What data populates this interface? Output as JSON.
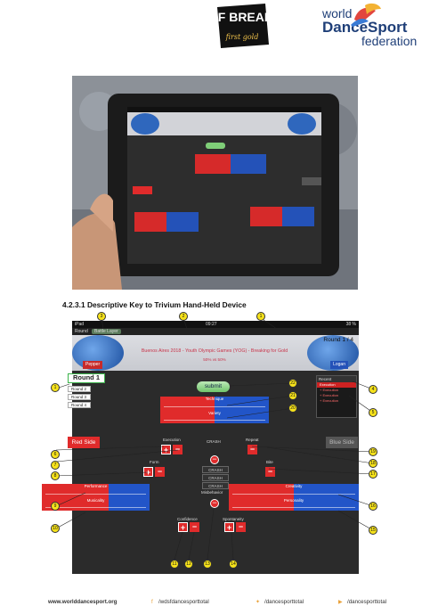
{
  "header": {
    "event_logo_text": "WDSF BREAKING",
    "event_logo_sub": "first gold",
    "org_world": "world",
    "org_dancesport": "DanceSport",
    "org_federation": "federation"
  },
  "section_title": "4.2.3.1 Descriptive Key to Trivium Hand-Held Device",
  "device": {
    "status_left": "iPad",
    "status_time": "09:27",
    "status_right": "38 %",
    "tab_round": "Round",
    "tab_pill": "Battle Layer",
    "round_counter": "Round 1 / 4",
    "event_title": "Buenos Aires 2018 - Youth Olympic Games (YOG) - Breaking for Gold",
    "event_sub": "50% vs 50%",
    "left_dancer": "Pepper",
    "right_dancer": "Logan",
    "round_selected": "Round 1",
    "rounds": [
      "Round 2",
      "Round 3",
      "Round 4"
    ],
    "submit_label": "submit",
    "recent": {
      "header": "Recent",
      "selected": "Execution",
      "items": [
        "+ Execution",
        "+ Execution",
        "+ Execution"
      ]
    },
    "red_side": "Red Side",
    "blue_side": "Blue Side",
    "bars": {
      "top_a": "Technique",
      "top_b": "Variety",
      "left_a": "Performance",
      "left_b": "Musicality",
      "right_a": "Creativity",
      "right_b": "Personality"
    },
    "labels": {
      "execution": "Execution",
      "repeat": "Repeat",
      "crash": "CRASH",
      "form": "Form",
      "bite": "Bite",
      "misbehavior": "Misbehavior",
      "confidence": "Confidence",
      "spontaneity": "Spontaneity"
    },
    "crash_list": [
      "CRASH",
      "CRASH",
      "CRASH"
    ]
  },
  "callouts": [
    "1",
    "2",
    "3",
    "4",
    "5",
    "6",
    "7",
    "8",
    "9",
    "10",
    "11",
    "12",
    "13",
    "14",
    "15",
    "16",
    "17",
    "18",
    "19",
    "20",
    "21",
    "22"
  ],
  "footer": {
    "site": "www.worlddancesport.org",
    "facebook": "/wdsfdancesporttotal",
    "twitter": "/dancesporttotal",
    "youtube": "/dancesporttotal"
  },
  "colors": {
    "red": "#e02b2b",
    "blue": "#2255c8",
    "callout": "#f6e21b",
    "submit_green": "#6fc46a"
  }
}
